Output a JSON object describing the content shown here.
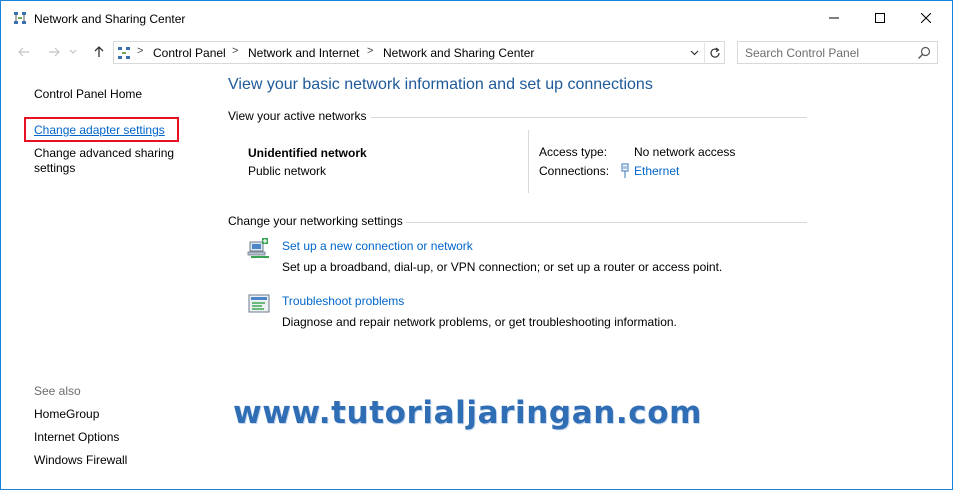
{
  "window": {
    "title": "Network and Sharing Center"
  },
  "address_bar": {
    "breadcrumbs": [
      "Control Panel",
      "Network and Internet",
      "Network and Sharing Center"
    ],
    "separator": ">"
  },
  "search": {
    "placeholder": "Search Control Panel"
  },
  "left_pane": {
    "home": "Control Panel Home",
    "links": [
      "Change adapter settings",
      "Change advanced sharing",
      "settings"
    ],
    "see_also_label": "See also",
    "see_also": [
      "HomeGroup",
      "Internet Options",
      "Windows Firewall"
    ]
  },
  "main": {
    "title": "View your basic network information and set up connections",
    "active_networks_heading": "View your active networks",
    "network": {
      "name": "Unidentified network",
      "category": "Public network",
      "access_type_label": "Access type:",
      "access_type_value": "No network access",
      "connections_label": "Connections:",
      "connections_value": "Ethernet"
    },
    "settings_heading": "Change your networking settings",
    "tasks": [
      {
        "link": "Set up a new connection or network",
        "desc": "Set up a broadband, dial-up, or VPN connection; or set up a router or access point.",
        "icon": "new-connection-icon"
      },
      {
        "link": "Troubleshoot problems",
        "desc": "Diagnose and repair network problems, or get troubleshooting information.",
        "icon": "troubleshoot-icon"
      }
    ]
  },
  "watermark": "www.tutorialjaringan.com",
  "colors": {
    "link": "#0066cc",
    "title": "#1e5a99",
    "highlight": "#e81123",
    "border": "#1883d7"
  }
}
